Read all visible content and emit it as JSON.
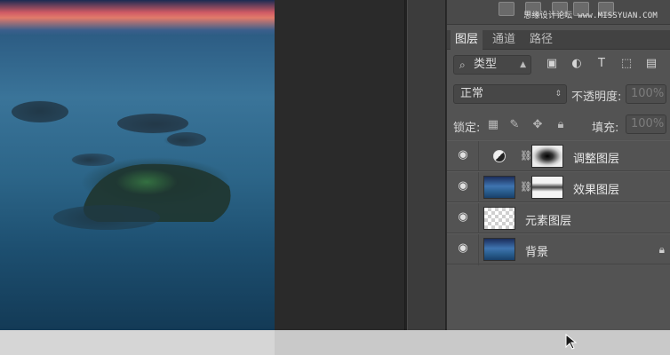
{
  "watermark": "思缘设计论坛 www.MISSYUAN.COM",
  "tabs": [
    {
      "label": "图层",
      "active": true
    },
    {
      "label": "通道",
      "active": false
    },
    {
      "label": "路径",
      "active": false
    }
  ],
  "filter": {
    "label": "类型",
    "icons": [
      "image-filter-icon",
      "adjustment-filter-icon",
      "type-filter-icon",
      "shape-filter-icon",
      "smart-object-filter-icon"
    ]
  },
  "blend": {
    "mode": "正常",
    "opacity_label": "不透明度:",
    "opacity_value": "100%"
  },
  "lock": {
    "label": "锁定:",
    "fill_label": "填充:",
    "fill_value": "100%"
  },
  "layers": [
    {
      "name": "调整图层",
      "type": "adjustment",
      "visible": true
    },
    {
      "name": "效果图层",
      "type": "masked-photo",
      "visible": true
    },
    {
      "name": "元素图层",
      "type": "empty",
      "visible": true
    },
    {
      "name": "背景",
      "type": "background",
      "visible": true,
      "locked": true
    }
  ]
}
